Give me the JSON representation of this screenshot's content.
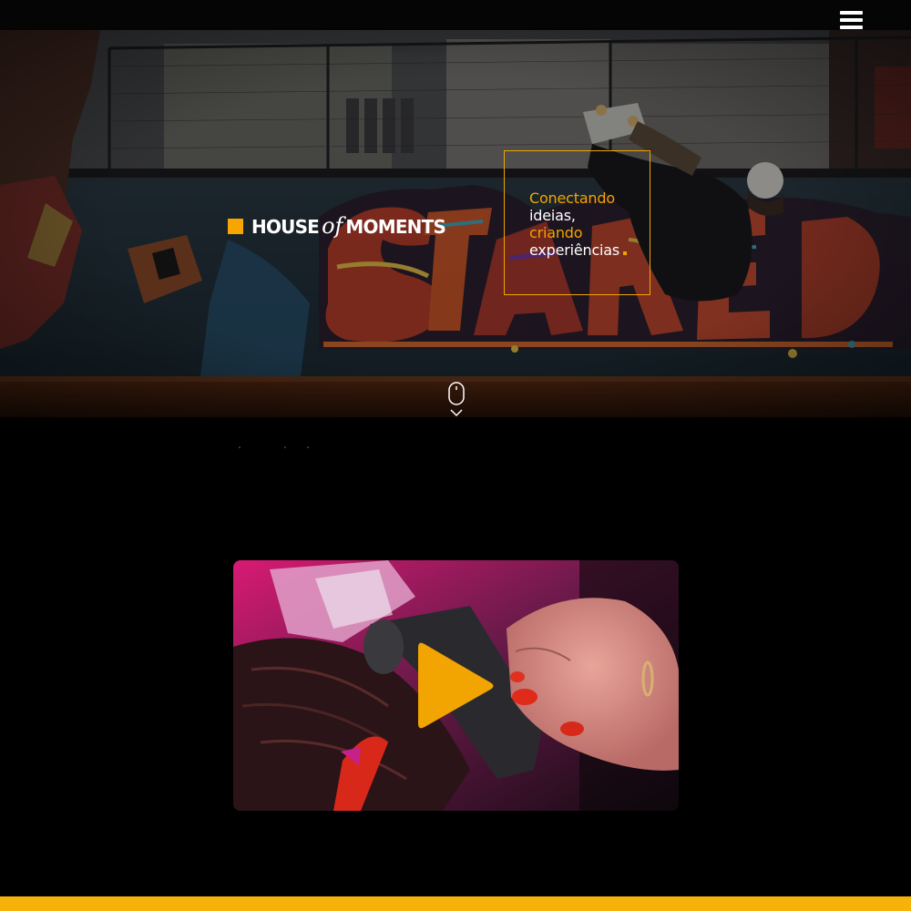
{
  "header": {
    "menu_icon": "hamburger-menu-icon"
  },
  "hero": {
    "brand": {
      "part1": "HOUSE",
      "part2": "of",
      "part3": "MOMENTS",
      "square_color": "#f7a600"
    },
    "tagline": {
      "line1": "Conectando",
      "line2": "ideias,",
      "line3": "criando",
      "line4": "experiências"
    },
    "scroll_icon": "mouse-scroll-icon",
    "accent_color": "#f0a500"
  },
  "video": {
    "play_icon": "play-icon",
    "play_color": "#f2a500"
  },
  "footer": {
    "bar_color": "#f6b20a"
  }
}
